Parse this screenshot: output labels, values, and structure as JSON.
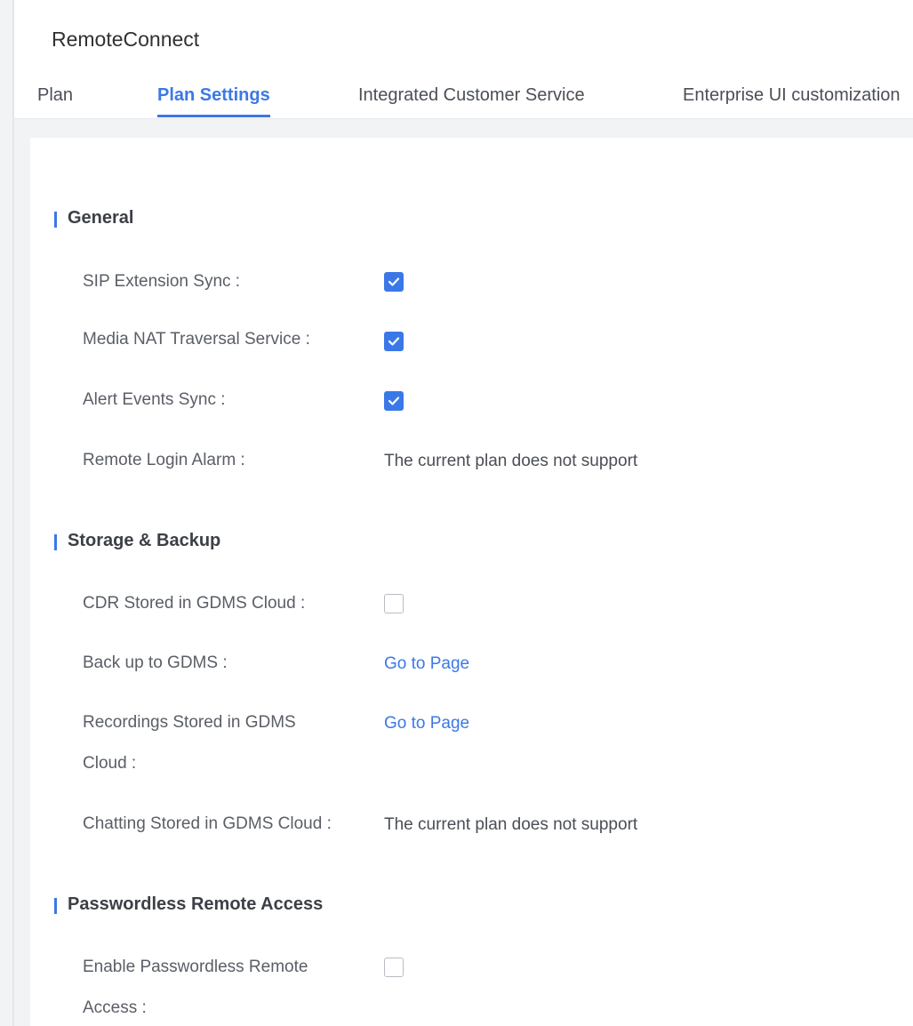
{
  "app": {
    "title": "RemoteConnect"
  },
  "tabs": [
    {
      "label": "Plan",
      "active": false
    },
    {
      "label": "Plan Settings",
      "active": true
    },
    {
      "label": "Integrated Customer Service",
      "active": false
    },
    {
      "label": "Enterprise UI customization",
      "active": false
    }
  ],
  "sections": {
    "general": {
      "title": "General",
      "sip_extension_sync": {
        "label": "SIP Extension Sync :",
        "checked": true
      },
      "media_nat": {
        "label": "Media NAT Traversal Service :",
        "checked": true
      },
      "alert_events": {
        "label": "Alert Events Sync :",
        "checked": true
      },
      "remote_login_alarm": {
        "label": "Remote Login Alarm :",
        "value": "The current plan does not support"
      }
    },
    "storage": {
      "title": "Storage & Backup",
      "cdr": {
        "label": "CDR Stored in GDMS Cloud :",
        "checked": false
      },
      "backup": {
        "label": "Back up to GDMS :",
        "link": "Go to Page"
      },
      "recordings": {
        "label_line1": "Recordings Stored in GDMS",
        "label_line2": "Cloud :",
        "link": "Go to Page"
      },
      "chatting": {
        "label": "Chatting Stored in GDMS Cloud :",
        "value": "The current plan does not support"
      }
    },
    "passwordless": {
      "title": "Passwordless Remote Access",
      "enable": {
        "label_line1": "Enable Passwordless Remote",
        "label_line2": "Access :",
        "checked": false
      }
    }
  },
  "colors": {
    "accent": "#3b78e7",
    "text": "#5a5e66",
    "heading": "#3c4046",
    "checkbox_border": "#b8bcc4"
  },
  "icons": {
    "checkmark": "check-icon"
  }
}
